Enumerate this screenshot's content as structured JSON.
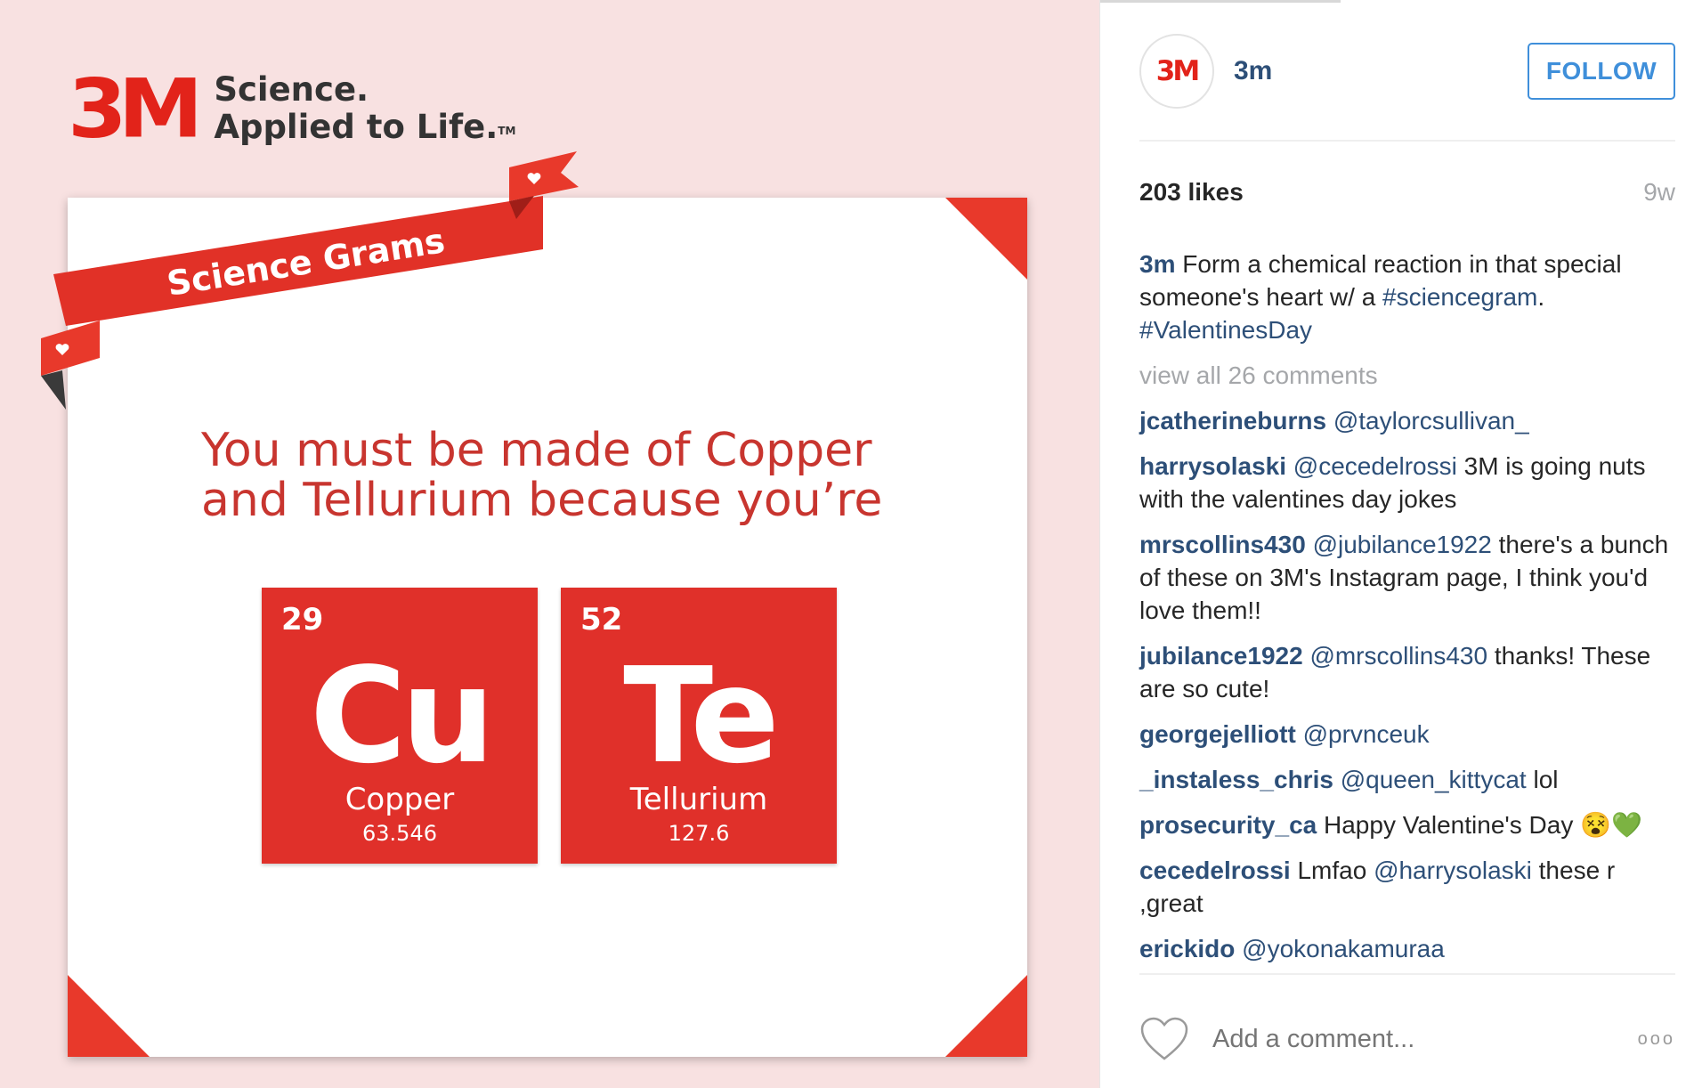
{
  "post_image": {
    "brand_logo": "3M",
    "brand_line1": "Science.",
    "brand_line2": "Applied to Life.",
    "brand_tm": "TM",
    "ribbon_text": "Science Grams",
    "headline_line1": "You must be made of Copper",
    "headline_line2": "and Tellurium because you’re",
    "tiles": [
      {
        "number": "29",
        "symbol": "Cu",
        "name": "Copper",
        "mass": "63.546"
      },
      {
        "number": "52",
        "symbol": "Te",
        "name": "Tellurium",
        "mass": "127.6"
      }
    ],
    "colors": {
      "brand_red": "#e2231a",
      "tile_red": "#e0302a",
      "background_pink": "#f8e1e1"
    }
  },
  "header": {
    "avatar_logo": "3M",
    "username": "3m",
    "follow_label": "FOLLOW"
  },
  "stats": {
    "likes": "203 likes",
    "age": "9w"
  },
  "caption": {
    "user": "3m",
    "text": "Form a chemical reaction in that special someone's heart w/ a",
    "hashtag1": "#sciencegram",
    "period": ".",
    "hashtag2": "#ValentinesDay"
  },
  "view_all": "view all 26 comments",
  "comments": [
    {
      "user": "jcatherineburns",
      "mention": "@taylorcsullivan_",
      "text": ""
    },
    {
      "user": "harrysolaski",
      "mention": "@cecedelrossi",
      "text": "3M is going nuts with the valentines day jokes"
    },
    {
      "user": "mrscollins430",
      "mention": "@jubilance1922",
      "text": "there's a bunch of these on 3M's Instagram page, I think you'd love them!!"
    },
    {
      "user": "jubilance1922",
      "mention": "@mrscollins430",
      "text": "thanks! These are so cute!"
    },
    {
      "user": "georgejelliott",
      "mention": "@prvnceuk",
      "text": ""
    },
    {
      "user": "_instaless_chris",
      "mention": "@queen_kittycat",
      "text": "lol"
    },
    {
      "user": "prosecurity_ca",
      "mention": "",
      "text": "Happy Valentine's Day 😵💚"
    },
    {
      "user": "cecedelrossi",
      "mention_pre": "Lmfao",
      "mention": "@harrysolaski",
      "text": "these r ,great"
    },
    {
      "user": "erickido",
      "mention": "@yokonakamuraa",
      "text": ""
    }
  ],
  "add_comment": {
    "placeholder": "Add a comment...",
    "more_label": "ooo"
  },
  "icons": {
    "like": "heart-icon",
    "more": "more-options-icon"
  }
}
